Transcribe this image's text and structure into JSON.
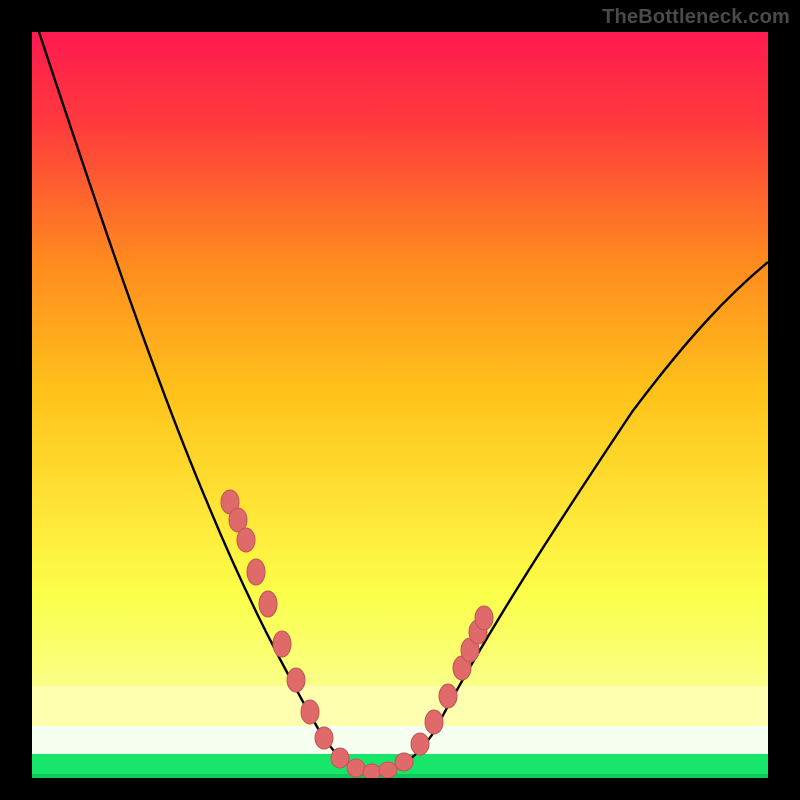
{
  "watermark": "TheBottleneck.com",
  "colors": {
    "frame": "#000000",
    "gradient_top": "#ff1a4f",
    "gradient_mid": "#ffd400",
    "gradient_low": "#ffff80",
    "gradient_bottom": "#17e66b",
    "curve": "#000000",
    "marker_fill": "#e06a6a",
    "marker_stroke": "#c05555"
  },
  "chart_data": {
    "type": "line",
    "title": "",
    "xlabel": "",
    "ylabel": "",
    "xlim": [
      0,
      100
    ],
    "ylim": [
      0,
      100
    ],
    "grid": false,
    "legend": false,
    "series": [
      {
        "name": "bottleneck-curve",
        "x": [
          1,
          5,
          10,
          15,
          20,
          25,
          28,
          30,
          32,
          34,
          36,
          38,
          40,
          42,
          44,
          46,
          48,
          50,
          55,
          60,
          65,
          70,
          75,
          80,
          85,
          90,
          95,
          100
        ],
        "y": [
          100,
          90,
          78,
          66,
          54,
          42,
          35,
          30,
          25,
          20,
          15,
          10,
          6,
          3,
          1,
          0.5,
          1,
          3,
          8,
          15,
          22,
          29,
          36,
          43,
          50,
          56,
          62,
          68
        ]
      }
    ],
    "markers": {
      "name": "highlighted-points",
      "x": [
        27,
        28,
        29,
        30.5,
        32,
        34,
        36,
        38,
        40,
        42,
        44,
        46,
        48,
        50,
        52,
        54,
        56,
        58,
        59,
        60,
        61
      ],
      "y": [
        37,
        35,
        33,
        28,
        24,
        18,
        13,
        9,
        5,
        3,
        1,
        0.5,
        1,
        3,
        5.5,
        9,
        12,
        16,
        18,
        20,
        22
      ]
    },
    "background_bands": [
      {
        "name": "red-orange-gradient",
        "y_from": 100,
        "y_to": 12
      },
      {
        "name": "pale-yellow-band",
        "y_from": 12,
        "y_to": 7
      },
      {
        "name": "white-band",
        "y_from": 7,
        "y_to": 3
      },
      {
        "name": "green-band",
        "y_from": 3,
        "y_to": 0
      }
    ]
  }
}
